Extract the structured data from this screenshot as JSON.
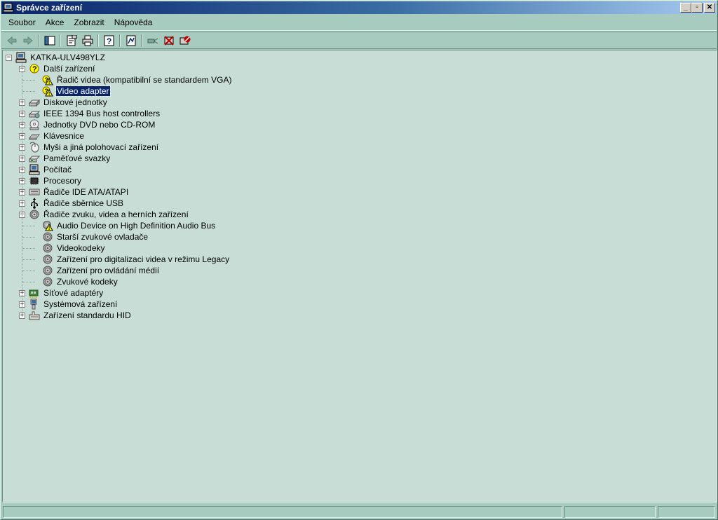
{
  "window": {
    "title": "Správce zařízení",
    "buttons": {
      "minimize": "_",
      "maximize": "▫",
      "close": "✕"
    }
  },
  "menu": [
    "Soubor",
    "Akce",
    "Zobrazit",
    "Nápověda"
  ],
  "toolbar": [
    "back-icon",
    "forward-icon",
    "console-tree-icon",
    "properties-icon",
    "print-icon",
    "help-icon",
    "scan-hardware-icon",
    "update-driver-icon",
    "uninstall-icon",
    "disable-icon"
  ],
  "tree": {
    "root": "KATKA-ULV498YLZ",
    "items": [
      {
        "label": "Další zařízení",
        "expanded": true,
        "icon": "unknown-device-icon",
        "children": [
          {
            "label": "Řadič videa (kompatibilní se standardem VGA)",
            "icon": "warning-device-icon"
          },
          {
            "label": "Video adapter",
            "icon": "warning-device-icon",
            "selected": true
          }
        ]
      },
      {
        "label": "Diskové jednotky",
        "expanded": false,
        "icon": "disk-drive-icon"
      },
      {
        "label": "IEEE 1394 Bus host controllers",
        "expanded": false,
        "icon": "ieee1394-icon"
      },
      {
        "label": "Jednotky DVD nebo CD-ROM",
        "expanded": false,
        "icon": "cdrom-icon"
      },
      {
        "label": "Klávesnice",
        "expanded": false,
        "icon": "keyboard-icon"
      },
      {
        "label": "Myši a jiná polohovací zařízení",
        "expanded": false,
        "icon": "mouse-icon"
      },
      {
        "label": "Paměťové svazky",
        "expanded": false,
        "icon": "storage-volume-icon"
      },
      {
        "label": "Počítač",
        "expanded": false,
        "icon": "computer-icon"
      },
      {
        "label": "Procesory",
        "expanded": false,
        "icon": "processor-icon"
      },
      {
        "label": "Řadiče IDE ATA/ATAPI",
        "expanded": false,
        "icon": "ide-controller-icon"
      },
      {
        "label": "Řadiče sběrnice USB",
        "expanded": false,
        "icon": "usb-icon"
      },
      {
        "label": "Řadiče zvuku, videa a herních zařízení",
        "expanded": true,
        "icon": "sound-icon",
        "children": [
          {
            "label": "Audio Device on High Definition Audio Bus",
            "icon": "warning-sound-icon"
          },
          {
            "label": "Starší zvukové ovladače",
            "icon": "sound-device-icon"
          },
          {
            "label": "Videokodeky",
            "icon": "sound-device-icon"
          },
          {
            "label": "Zařízení pro digitalizaci videa v režimu Legacy",
            "icon": "sound-device-icon"
          },
          {
            "label": "Zařízení pro ovládání médií",
            "icon": "sound-device-icon"
          },
          {
            "label": "Zvukové kodeky",
            "icon": "sound-device-icon"
          }
        ]
      },
      {
        "label": "Síťové adaptéry",
        "expanded": false,
        "icon": "network-adapter-icon"
      },
      {
        "label": "Systémová zařízení",
        "expanded": false,
        "icon": "system-device-icon"
      },
      {
        "label": "Zařízení standardu HID",
        "expanded": false,
        "icon": "hid-icon"
      }
    ]
  },
  "statusbar": {
    "panes": [
      "",
      "",
      ""
    ]
  },
  "colors": {
    "window_bg": "#a8cbc0",
    "tree_bg": "#c7ddd5",
    "title_start": "#0a246a",
    "selection": "#0a246a"
  }
}
